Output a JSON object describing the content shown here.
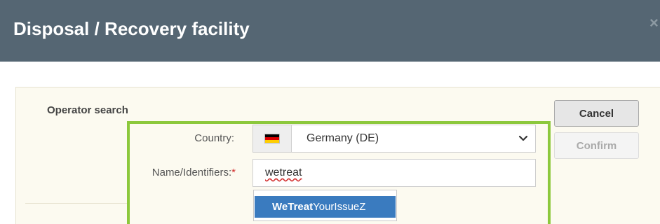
{
  "dialog": {
    "title": "Disposal / Recovery facility",
    "close_symbol": "×"
  },
  "operator_search": {
    "section_title": "Operator search",
    "country": {
      "label": "Country:",
      "value": "Germany (DE)",
      "flag_icon": "germany-flag-icon",
      "flag_colors": [
        "#000000",
        "#dd0000",
        "#ffce00"
      ]
    },
    "name": {
      "label": "Name/Identifiers:",
      "required_marker": "*",
      "value": "wetreat"
    },
    "suggestions": [
      {
        "match": "WeTreat",
        "rest": "YourIssueZ"
      }
    ]
  },
  "buttons": {
    "cancel_label": "Cancel",
    "confirm_label": "Confirm"
  },
  "colors": {
    "header_bg": "#556673",
    "highlight_border": "#8cc83c",
    "suggestion_bg": "#3a7bbf",
    "required": "#d32f2f"
  }
}
